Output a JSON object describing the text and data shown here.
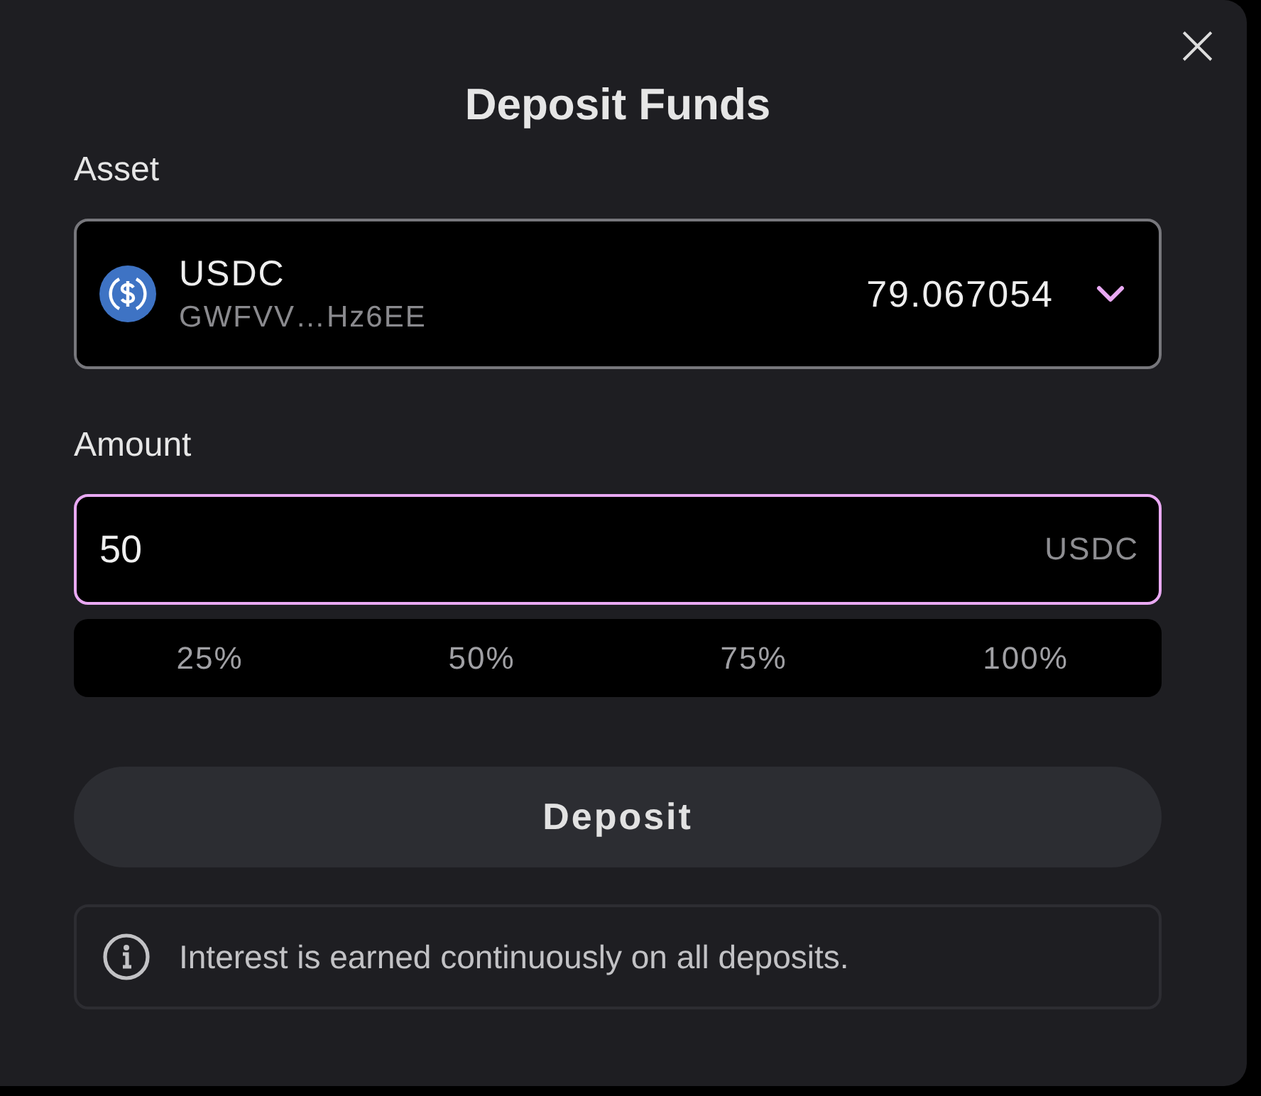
{
  "dialog": {
    "title": "Deposit Funds",
    "close": "×"
  },
  "asset": {
    "label": "Asset",
    "symbol": "USDC",
    "address": "GWFVV…Hz6EE",
    "balance": "79.067054"
  },
  "amount": {
    "label": "Amount",
    "value": "50",
    "unit": "USDC",
    "focused": true
  },
  "percent_options": [
    "25%",
    "50%",
    "75%",
    "100%"
  ],
  "submit": "Deposit",
  "notice": "Interest is earned continuously on all deposits."
}
